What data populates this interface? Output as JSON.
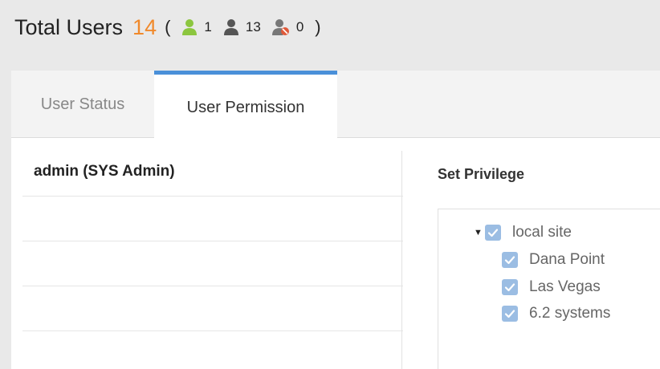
{
  "header": {
    "title": "Total Users",
    "total": "14",
    "paren_open": "(",
    "paren_close": ")",
    "stats": [
      {
        "icon": "user-online-icon",
        "color": "#8cc63f",
        "value": "1"
      },
      {
        "icon": "user-offline-icon",
        "color": "#555555",
        "value": "13"
      },
      {
        "icon": "user-blocked-icon",
        "color": "#777777",
        "badge_color": "#e05a3a",
        "value": "0"
      }
    ]
  },
  "tabs": [
    {
      "label": "User Status",
      "active": false
    },
    {
      "label": "User Permission",
      "active": true
    }
  ],
  "users": [
    "admin  (SYS Admin)",
    "",
    "",
    "",
    ""
  ],
  "privilege": {
    "title": "Set Privilege",
    "tree": [
      {
        "label": "local site",
        "checked": true,
        "expanded": true
      },
      {
        "label": "Dana Point",
        "checked": true
      },
      {
        "label": "Las Vegas",
        "checked": true
      },
      {
        "label": "6.2 systems",
        "checked": true
      }
    ]
  },
  "colors": {
    "accent": "#f0892b",
    "tab_active": "#4a90d9",
    "checkbox": "#9bbde3"
  }
}
